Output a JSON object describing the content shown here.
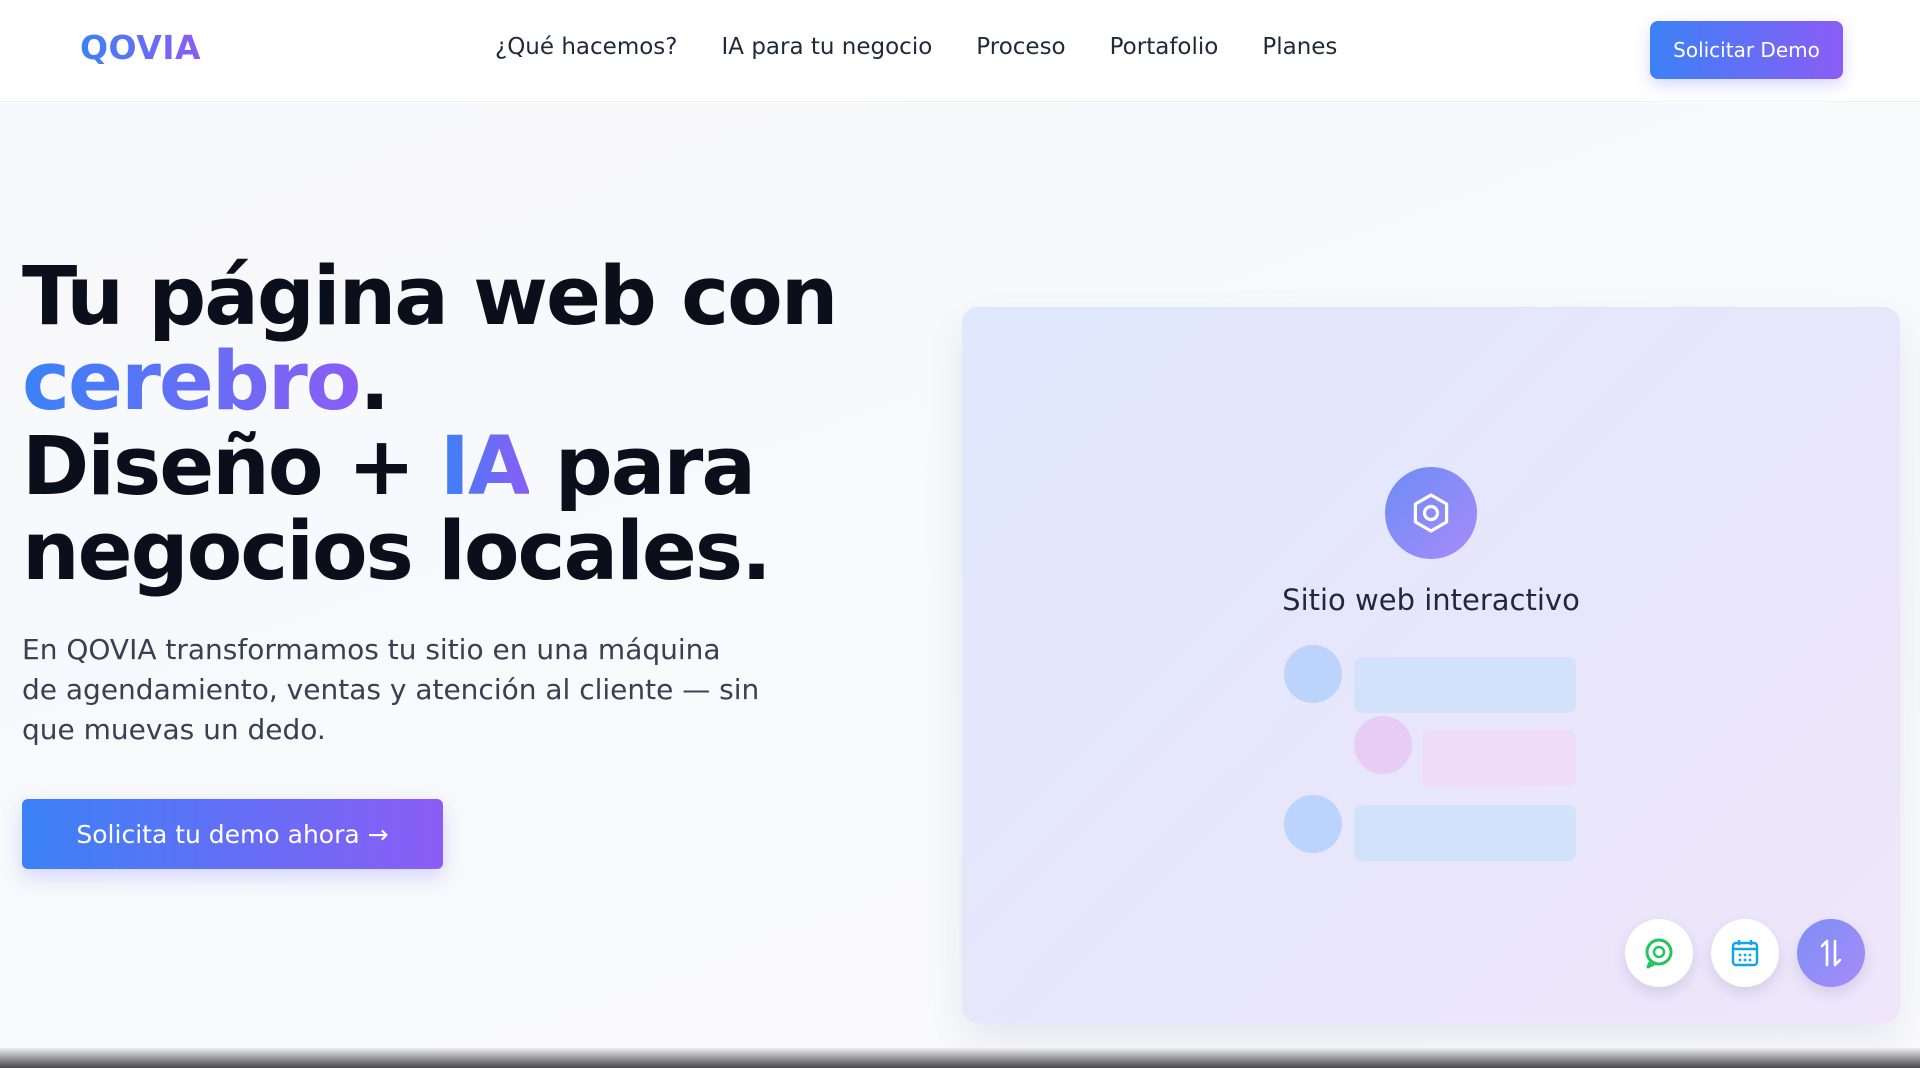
{
  "brand": {
    "name": "QOVIA"
  },
  "nav": {
    "links": [
      "¿Qué hacemos?",
      "IA para tu negocio",
      "Proceso",
      "Portafolio",
      "Planes"
    ],
    "cta_label": "Solicitar Demo"
  },
  "hero": {
    "title_line1": "Tu página web con",
    "title_highlight": "cerebro",
    "title_period": ".",
    "title_line3_pre": "Diseño + ",
    "title_line3_highlight": "IA",
    "title_line3_post": " para",
    "title_line4": "negocios locales.",
    "subtitle": "En QOVIA transformamos tu sitio en una máquina de agendamiento, ventas y atención al cliente — sin que muevas un dedo.",
    "cta_label": "Solicita tu demo ahora →"
  },
  "preview": {
    "title": "Sitio web interactivo",
    "hub_icon": "gear-icon",
    "action_icons": [
      "chat-icon",
      "calendar-icon",
      "sort-icon"
    ]
  },
  "colors": {
    "accent_start": "#3b82f6",
    "accent_end": "#8b5cf6",
    "chat_green": "#22c55e",
    "calendar_blue": "#0ea5e9"
  }
}
